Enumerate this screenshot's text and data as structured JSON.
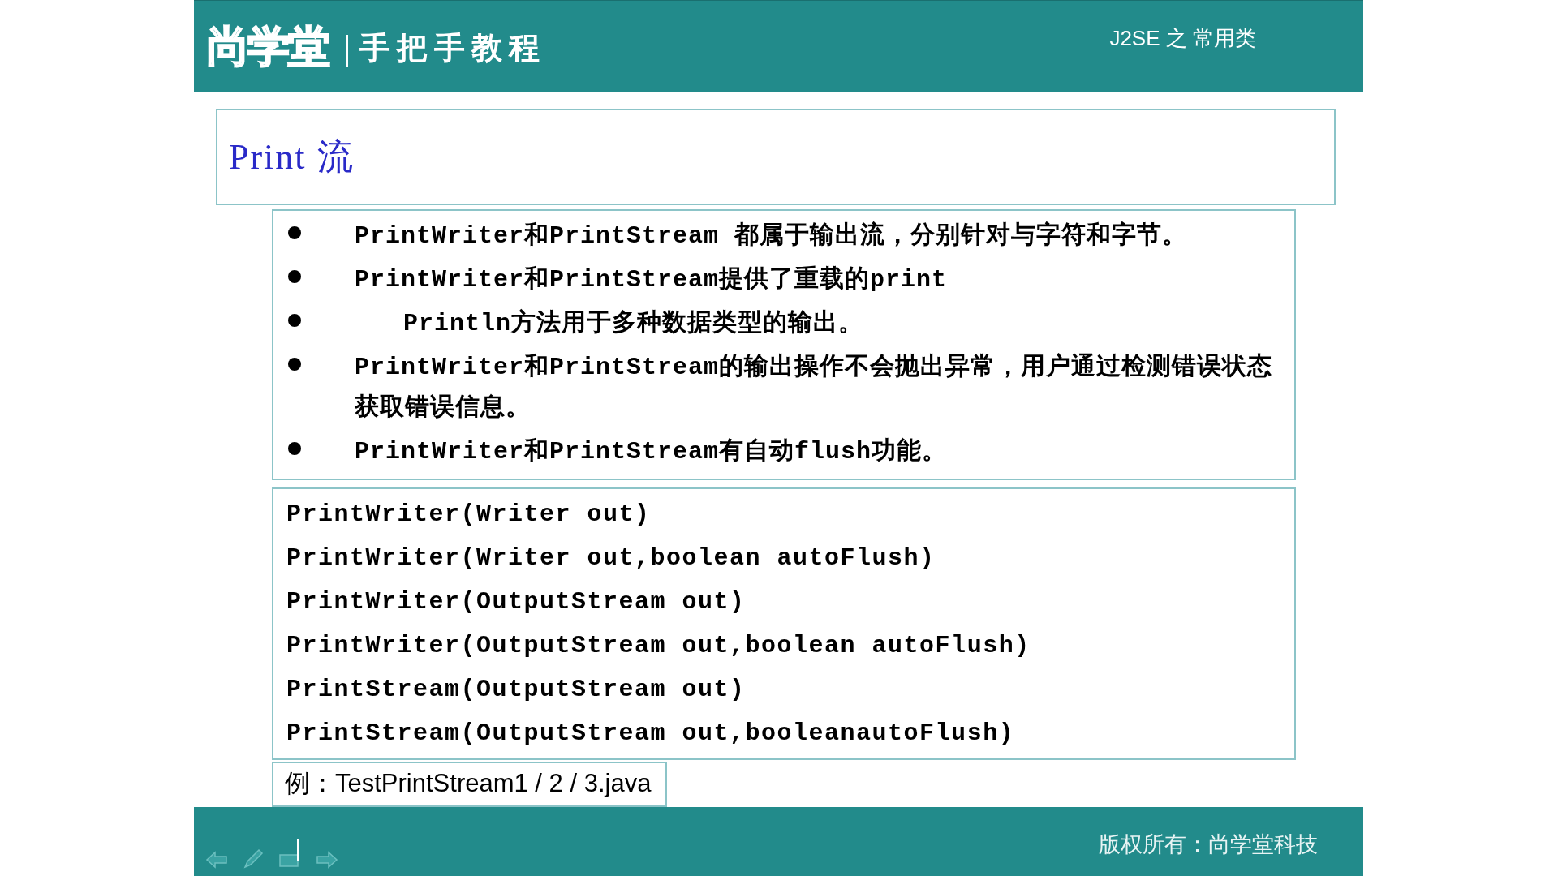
{
  "header": {
    "logo": "尚学堂",
    "subtitle": "手把手教程",
    "course": "J2SE 之 常用类"
  },
  "title": "Print 流",
  "bullets": [
    {
      "kind": "item",
      "text": "PrintWriter和PrintStream 都属于输出流，分别针对与字符和字节。"
    },
    {
      "kind": "item",
      "text": "PrintWriter和PrintStream提供了重载的print"
    },
    {
      "kind": "indented",
      "text": "Println方法用于多种数据类型的输出。"
    },
    {
      "kind": "item",
      "text": "PrintWriter和PrintStream的输出操作不会抛出异常，用户通过检测错误状态获取错误信息。"
    },
    {
      "kind": "item",
      "text": "PrintWriter和PrintStream有自动flush功能。"
    }
  ],
  "code_lines": [
    "PrintWriter(Writer out)",
    "PrintWriter(Writer out,boolean autoFlush)",
    "PrintWriter(OutputStream out)",
    "PrintWriter(OutputStream out,boolean autoFlush)",
    "PrintStream(OutputStream out)",
    "PrintStream(OutputStream out,booleanautoFlush)"
  ],
  "example": "例：TestPrintStream1 / 2 / 3.java",
  "footer": {
    "copyright": "版权所有：尚学堂科技"
  }
}
